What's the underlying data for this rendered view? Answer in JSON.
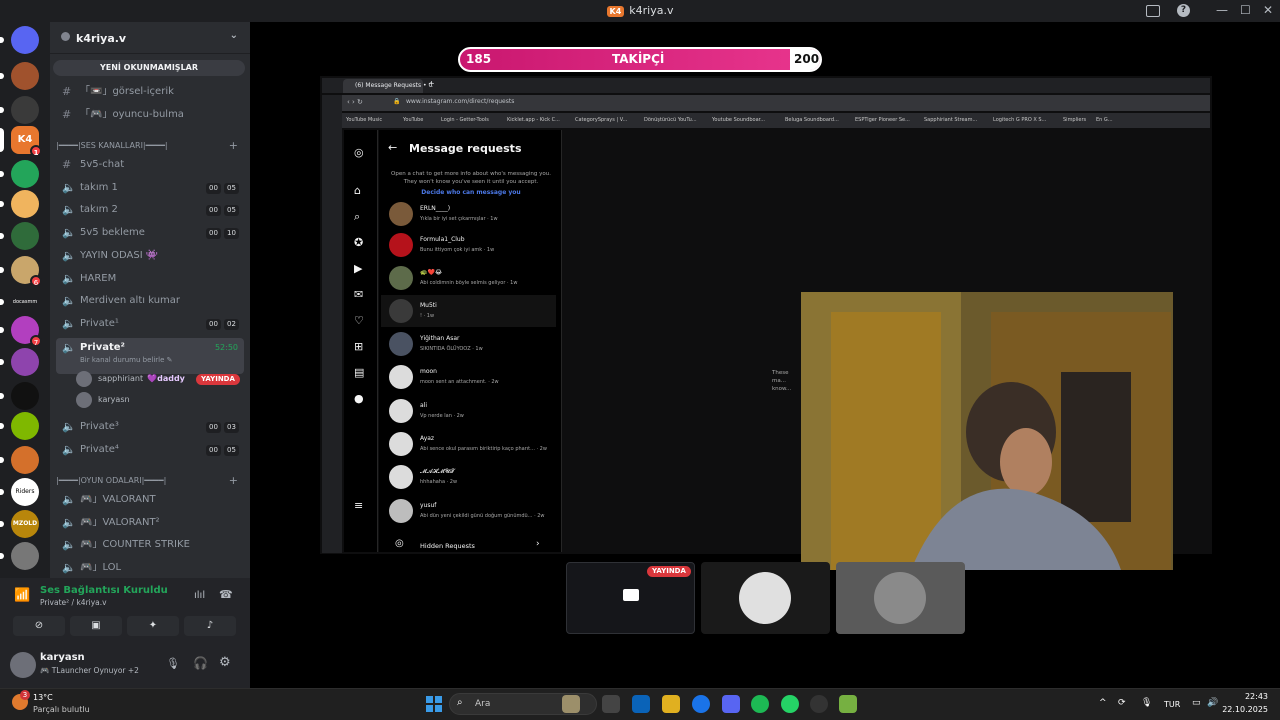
{
  "window": {
    "title": "k4riya.v",
    "min": "—",
    "max": "☐",
    "close": "✕"
  },
  "servers": {
    "items": [
      {
        "color": "#5865f2",
        "badge": ""
      },
      {
        "color": "#a0522d",
        "badge": ""
      },
      {
        "color": "#3a3a3a",
        "badge": ""
      },
      {
        "color": "#e8772e",
        "badge": "1"
      },
      {
        "color": "#23a55a",
        "badge": ""
      },
      {
        "color": "#f0b45e",
        "badge": ""
      },
      {
        "color": "#2f6b3a",
        "badge": ""
      },
      {
        "color": "#c9a66b",
        "badge": "6"
      },
      {
        "color": "#1e1f22",
        "badge": ""
      },
      {
        "color": "#b23fbf",
        "badge": "7"
      },
      {
        "color": "#8e44ad",
        "badge": ""
      },
      {
        "color": "#111111",
        "badge": ""
      },
      {
        "color": "#7fb800",
        "badge": ""
      },
      {
        "color": "#d4702b",
        "badge": ""
      },
      {
        "color": "#ffffff",
        "badge": ""
      },
      {
        "color": "#b8860b",
        "badge": ""
      },
      {
        "color": "#777777",
        "badge": ""
      }
    ],
    "docs_label": "docasmm",
    "riders_label": "Riders",
    "mzold_label": "MZOLD"
  },
  "server": {
    "name": "k4riya.v",
    "unread_banner": "YENİ OKUNMAMIŞLAR"
  },
  "text_channels": [
    {
      "name": "「📼」görsel-içerik"
    },
    {
      "name": "「🎮」oyuncu-bulma"
    }
  ],
  "voice_category": "|━━━━|SES KANALLARI|━━━━|",
  "voice_channels": [
    {
      "icon": "#",
      "name": "5v5-chat",
      "a": "",
      "b": ""
    },
    {
      "icon": "🔊",
      "name": "takım 1",
      "a": "00",
      "b": "05"
    },
    {
      "icon": "🔊",
      "name": "takım 2",
      "a": "00",
      "b": "05"
    },
    {
      "icon": "🔊",
      "name": "5v5 bekleme",
      "a": "00",
      "b": "10"
    },
    {
      "icon": "🔊",
      "name": "YAYIN ODASI 👾",
      "a": "",
      "b": ""
    },
    {
      "icon": "🔊",
      "name": "HAREM",
      "a": "",
      "b": ""
    },
    {
      "icon": "🔊",
      "name": "Merdiven altı kumar",
      "a": "",
      "b": ""
    },
    {
      "icon": "🔊",
      "name": "Private¹",
      "a": "00",
      "b": "02"
    }
  ],
  "active_channel": {
    "name": "Private²",
    "timer": "52:50",
    "status": "Bir kanal durumu belirle ✎"
  },
  "members": [
    {
      "name": "sapphiriant",
      "tag": "💜daddy",
      "live": "YAYINDA"
    },
    {
      "name": "karyasn",
      "tag": "",
      "live": ""
    }
  ],
  "voice_channels_2": [
    {
      "name": "Private³",
      "a": "00",
      "b": "03"
    },
    {
      "name": "Private⁴",
      "a": "00",
      "b": "05"
    }
  ],
  "game_category": "|━━━━|OYUN ODALARI|━━━━|",
  "game_channels": [
    {
      "name": "🎮」VALORANT"
    },
    {
      "name": "🎮」VALORANT²"
    },
    {
      "name": "🎮」COUNTER STRIKE"
    },
    {
      "name": "🎮」LOL"
    }
  ],
  "voice_panel": {
    "status": "Ses Bağlantısı Kuruldu",
    "sub": "Private² / k4riya.v"
  },
  "user": {
    "name": "karyasn",
    "status": "🎮 TLauncher Oynuyor +2"
  },
  "follower_bar": {
    "left": "185",
    "label": "TAKİPÇİ",
    "right": "200",
    "progress": 0.925
  },
  "browser": {
    "tab_title": "(6) Message Requests • C",
    "url": "www.instagram.com/direct/requests",
    "bookmarks": [
      "YouTube Music",
      "YouTube",
      "Login - Getter-Tools",
      "Kicklet.app - Kick C...",
      "CategorySprays | V...",
      "Dönüştürücü YouTu...",
      "Youtube Soundboar...",
      "Beluga Soundboard...",
      "ESPTiger Pioneer Se...",
      "Sapphiriant Stream...",
      "Logitech G PRO X S...",
      "Simpliers",
      "En G..."
    ]
  },
  "instagram": {
    "title": "Message requests",
    "info": "Open a chat to get more info about who's messaging you. They won't know you've seen it until you accept.",
    "decide": "Decide who can message you",
    "requests": [
      {
        "name": "ERLN____)",
        "msg": "Yıkla bir iyi set çıkarmışlar · 1w"
      },
      {
        "name": "Formula1_Club",
        "msg": "Bunu ittiyom çok iyi amk · 1w"
      },
      {
        "name": "🐢❤️😂",
        "msg": "Abi coldimnin böyle selmis geliyor · 1w"
      },
      {
        "name": "Mu5ti",
        "msg": "! · 1w"
      },
      {
        "name": "Yiğithan Asar",
        "msg": "SIKINTIDA ÖLÜYOOZ · 1w"
      },
      {
        "name": "moon",
        "msg": "moon sent an attachment. · 2w"
      },
      {
        "name": "ali",
        "msg": "Vp nerde lan · 2w"
      },
      {
        "name": "Ayaz",
        "msg": "Abi sence okul parasım biriktirip kaço pharıt... · 2w"
      },
      {
        "name": "𝓜𝓐𝓗𝓜𝓤𝓣",
        "msg": "hhhahaha · 2w"
      },
      {
        "name": "yusuf",
        "msg": "Abi dün yeni çekildi günü doğum günümdü... · 2w"
      }
    ],
    "hidden": "Hidden Requests",
    "empty_hint": "These ma... know..."
  },
  "thumbs": {
    "live": "YAYINDA"
  },
  "taskbar": {
    "temp": "13°C",
    "weather": "Parçalı bulutlu",
    "weather_badge": "3",
    "search_placeholder": "Ara",
    "lang": "TUR",
    "time": "22:43",
    "date": "22.10.2025"
  }
}
